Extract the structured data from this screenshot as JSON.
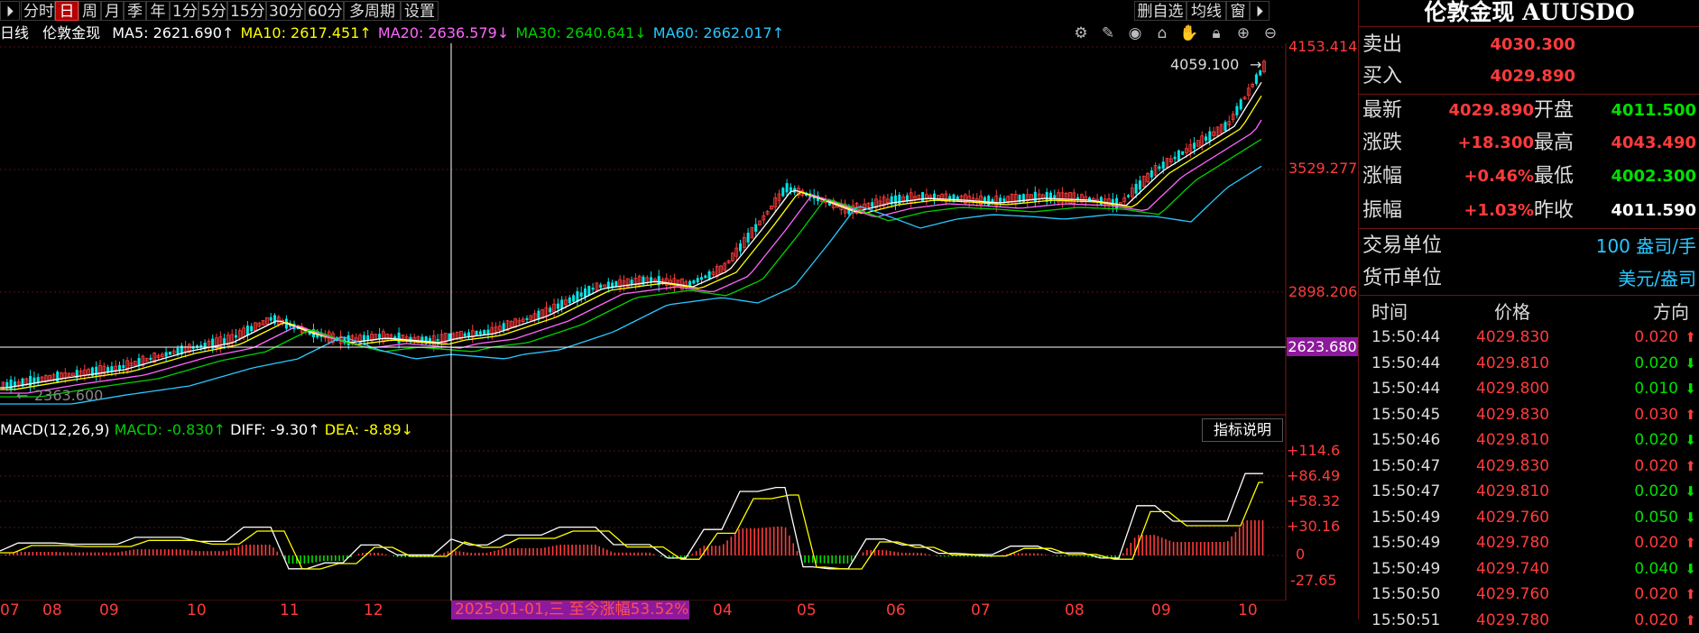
{
  "toolbar": {
    "left": [
      "分时",
      "日",
      "周",
      "月",
      "季",
      "年",
      "1分",
      "5分",
      "15分",
      "30分",
      "60分",
      "多周期",
      "设置"
    ],
    "active_index": 1,
    "right": [
      "删自选",
      "均线",
      "窗"
    ]
  },
  "ma_legend": {
    "period": "日线",
    "name": "伦敦金现",
    "ma5": "MA5: 2621.690↑",
    "ma10": "MA10: 2617.451↑",
    "ma20": "MA20: 2636.579↓",
    "ma30": "MA30: 2640.641↓",
    "ma60": "MA60: 2662.017↑"
  },
  "price_axis": [
    "4153.414",
    "3529.277",
    "2898.206"
  ],
  "crosshair_price": "2623.680",
  "high_marker": "4059.100",
  "low_marker": "2363.600",
  "macd_legend": {
    "label": "MACD(12,26,9)",
    "macd": "MACD: -0.830↑",
    "diff": "DIFF: -9.30↑",
    "dea": "DEA: -8.89↓",
    "help": "指标说明"
  },
  "macd_axis": [
    "+114.6",
    "+86.49",
    "+58.32",
    "+30.16",
    "0",
    "-27.65"
  ],
  "x_axis": [
    "07",
    "08",
    "09",
    "10",
    "11",
    "12",
    "04",
    "05",
    "06",
    "07",
    "08",
    "09",
    "10"
  ],
  "x_highlight": "2025-01-01,三 至今涨幅53.52%",
  "panel": {
    "title": "伦敦金现 AUUSDO",
    "sell_label": "卖出",
    "sell": "4030.300",
    "buy_label": "买入",
    "buy": "4029.890",
    "rows": [
      {
        "l1": "最新",
        "v1": "4029.890",
        "l2": "开盘",
        "v2": "4011.500"
      },
      {
        "l1": "涨跌",
        "v1": "+18.300",
        "l2": "最高",
        "v2": "4043.490"
      },
      {
        "l1": "涨幅",
        "v1": "+0.46%",
        "l2": "最低",
        "v2": "4002.300"
      },
      {
        "l1": "振幅",
        "v1": "+1.03%",
        "l2": "昨收",
        "v2": "4011.590"
      }
    ],
    "unit_label": "交易单位",
    "unit_value": "100 盎司/手",
    "currency_label": "货币单位",
    "currency_value": "美元/盎司",
    "tick_headers": [
      "时间",
      "价格",
      "方向"
    ],
    "ticks": [
      {
        "time": "15:50:44",
        "price": "4029.830",
        "vol": "0.020",
        "dir": "up"
      },
      {
        "time": "15:50:44",
        "price": "4029.810",
        "vol": "0.020",
        "dir": "down"
      },
      {
        "time": "15:50:44",
        "price": "4029.800",
        "vol": "0.010",
        "dir": "down"
      },
      {
        "time": "15:50:45",
        "price": "4029.830",
        "vol": "0.030",
        "dir": "up"
      },
      {
        "time": "15:50:46",
        "price": "4029.810",
        "vol": "0.020",
        "dir": "down"
      },
      {
        "time": "15:50:47",
        "price": "4029.830",
        "vol": "0.020",
        "dir": "up"
      },
      {
        "time": "15:50:47",
        "price": "4029.810",
        "vol": "0.020",
        "dir": "down"
      },
      {
        "time": "15:50:49",
        "price": "4029.760",
        "vol": "0.050",
        "dir": "down"
      },
      {
        "time": "15:50:49",
        "price": "4029.780",
        "vol": "0.020",
        "dir": "up"
      },
      {
        "time": "15:50:49",
        "price": "4029.740",
        "vol": "0.040",
        "dir": "down"
      },
      {
        "time": "15:50:50",
        "price": "4029.760",
        "vol": "0.020",
        "dir": "up"
      },
      {
        "time": "15:50:51",
        "price": "4029.780",
        "vol": "0.020",
        "dir": "up"
      }
    ]
  },
  "colors": {
    "up": "#ff3b3b",
    "down": "#00e000",
    "ma5": "#ffffff",
    "ma10": "#ffff00",
    "ma20": "#ff66ff",
    "ma30": "#00d000",
    "ma60": "#28c8ff"
  }
}
